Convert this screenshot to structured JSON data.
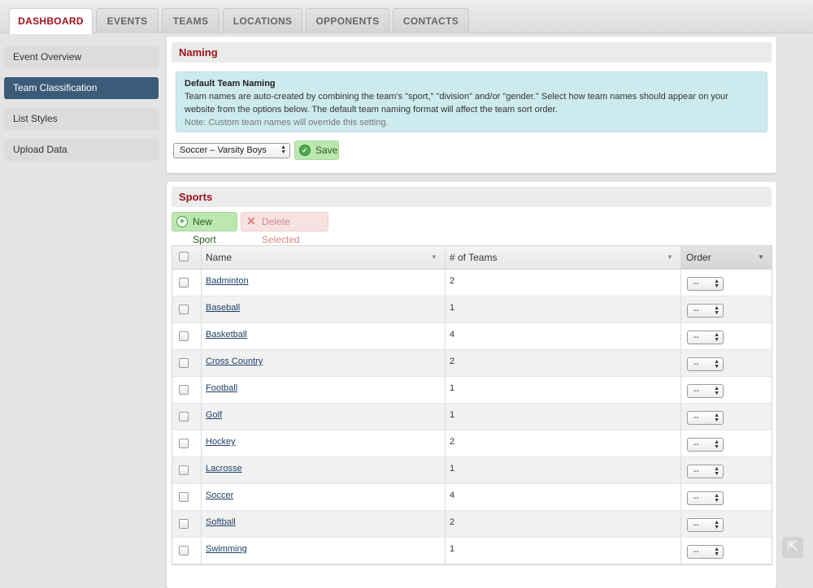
{
  "tabs": [
    "DASHBOARD",
    "EVENTS",
    "TEAMS",
    "LOCATIONS",
    "OPPONENTS",
    "CONTACTS"
  ],
  "sidebar": [
    "Event Overview",
    "Team Classification",
    "List Styles",
    "Upload Data"
  ],
  "naming": {
    "title": "Naming",
    "info_title": "Default Team Naming",
    "info_line1": "Team names are auto-created by combining the team's \"sport,\" \"division\" and/or \"gender.\" Select how team names should appear on your",
    "info_line2": "website from the options below. The default team naming format will affect the team sort order.",
    "info_note": "Note: Custom team names will override this setting.",
    "select_value": "Soccer – Varsity Boys",
    "save_label": "Save"
  },
  "sports": {
    "title": "Sports",
    "new_label": "New Sport",
    "delete_label": "Delete Selected",
    "columns": [
      "Name",
      "# of Teams",
      "Order"
    ],
    "order_placeholder": "-- ",
    "rows": [
      {
        "name": "Badminton",
        "teams": "2"
      },
      {
        "name": "Baseball",
        "teams": "1"
      },
      {
        "name": "Basketball",
        "teams": "4"
      },
      {
        "name": "Cross Country",
        "teams": "2"
      },
      {
        "name": "Football",
        "teams": "1"
      },
      {
        "name": "Golf",
        "teams": "1"
      },
      {
        "name": "Hockey",
        "teams": "2"
      },
      {
        "name": "Lacrosse",
        "teams": "1"
      },
      {
        "name": "Soccer",
        "teams": "4"
      },
      {
        "name": "Softball",
        "teams": "2"
      },
      {
        "name": "Swimming",
        "teams": "1"
      }
    ]
  }
}
